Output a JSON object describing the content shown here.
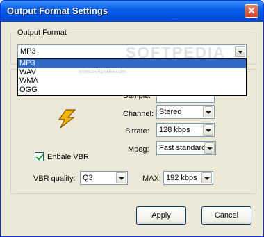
{
  "window": {
    "title": "Output Format Settings",
    "close_icon": "close-icon"
  },
  "output_format": {
    "legend": "Output Format",
    "selected": "MP3",
    "options": [
      "MP3",
      "WAV",
      "WMA",
      "OGG"
    ]
  },
  "settings": {
    "sample_label": "Sample:",
    "channel_label": "Channel:",
    "channel_value": "Stereo",
    "bitrate_label": "Bitrate:",
    "bitrate_value": "128 kbps",
    "mpeg_label": "Mpeg:",
    "mpeg_value": "Fast standard",
    "vbr_label": "Enbale VBR",
    "vbr_checked": true,
    "vbr_quality_label": "VBR quality:",
    "vbr_quality_value": "Q3",
    "max_label": "MAX:",
    "max_value": "192 kbps"
  },
  "buttons": {
    "apply": "Apply",
    "cancel": "Cancel"
  },
  "watermark": {
    "big": "SOFTPEDIA",
    "small": "www.softpedia.com"
  }
}
